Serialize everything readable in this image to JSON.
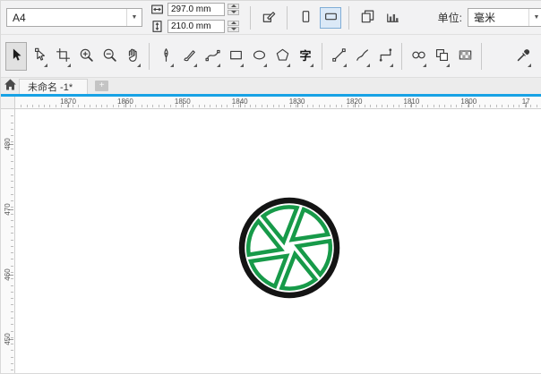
{
  "propbar": {
    "preset_label": "A4",
    "page_width": "297.0 mm",
    "page_height": "210.0 mm",
    "units_label": "单位:",
    "units_value": "毫米",
    "buttons": [
      {
        "sep": true
      },
      {
        "icon": "page-edit-icon"
      },
      {
        "sep": true
      },
      {
        "icon": "portrait-icon"
      },
      {
        "icon": "landscape-icon",
        "active": true
      },
      {
        "sep": true
      },
      {
        "icon": "all-pages-icon"
      },
      {
        "icon": "current-page-icon"
      }
    ]
  },
  "toolbox": [
    {
      "icon": "pick-tool",
      "active": true
    },
    {
      "icon": "shape-tool",
      "flyout": true
    },
    {
      "icon": "crop-tool",
      "flyout": true
    },
    {
      "icon": "zoom-in-tool"
    },
    {
      "icon": "zoom-out-tool"
    },
    {
      "icon": "pan-tool",
      "flyout": true
    },
    {
      "sep": true
    },
    {
      "icon": "pen-nib-tool",
      "flyout": true
    },
    {
      "icon": "brush-tool",
      "flyout": true
    },
    {
      "icon": "bspline-tool",
      "flyout": true
    },
    {
      "icon": "rectangle-tool",
      "flyout": true
    },
    {
      "icon": "ellipse-tool",
      "flyout": true
    },
    {
      "icon": "polygon-tool",
      "flyout": true
    },
    {
      "icon": "text-tool",
      "text": "字",
      "flyout": true
    },
    {
      "sep": true
    },
    {
      "icon": "line-tool",
      "flyout": true
    },
    {
      "icon": "freehand-tool",
      "flyout": true
    },
    {
      "icon": "connector-tool",
      "flyout": true
    },
    {
      "sep": true
    },
    {
      "icon": "blend-tool",
      "flyout": true
    },
    {
      "icon": "contour-tool",
      "flyout": true
    },
    {
      "icon": "transparency-tool"
    },
    {
      "sep": true
    },
    {
      "icon": "eyedropper-tool",
      "flyout": true
    }
  ],
  "tabbar": {
    "tab_title": "未命名 -1*",
    "new_tab_label": "+"
  },
  "rulers": {
    "horizontal_labels": [
      "1870",
      "1860",
      "1850",
      "1840",
      "1830",
      "1820",
      "1810",
      "1800",
      "17"
    ],
    "vertical_labels": [
      "480",
      "470",
      "460",
      "450"
    ]
  },
  "logo": {
    "ring_color": "#141414",
    "segment_color": "#179a49",
    "segment_fill": "#ffffff"
  }
}
